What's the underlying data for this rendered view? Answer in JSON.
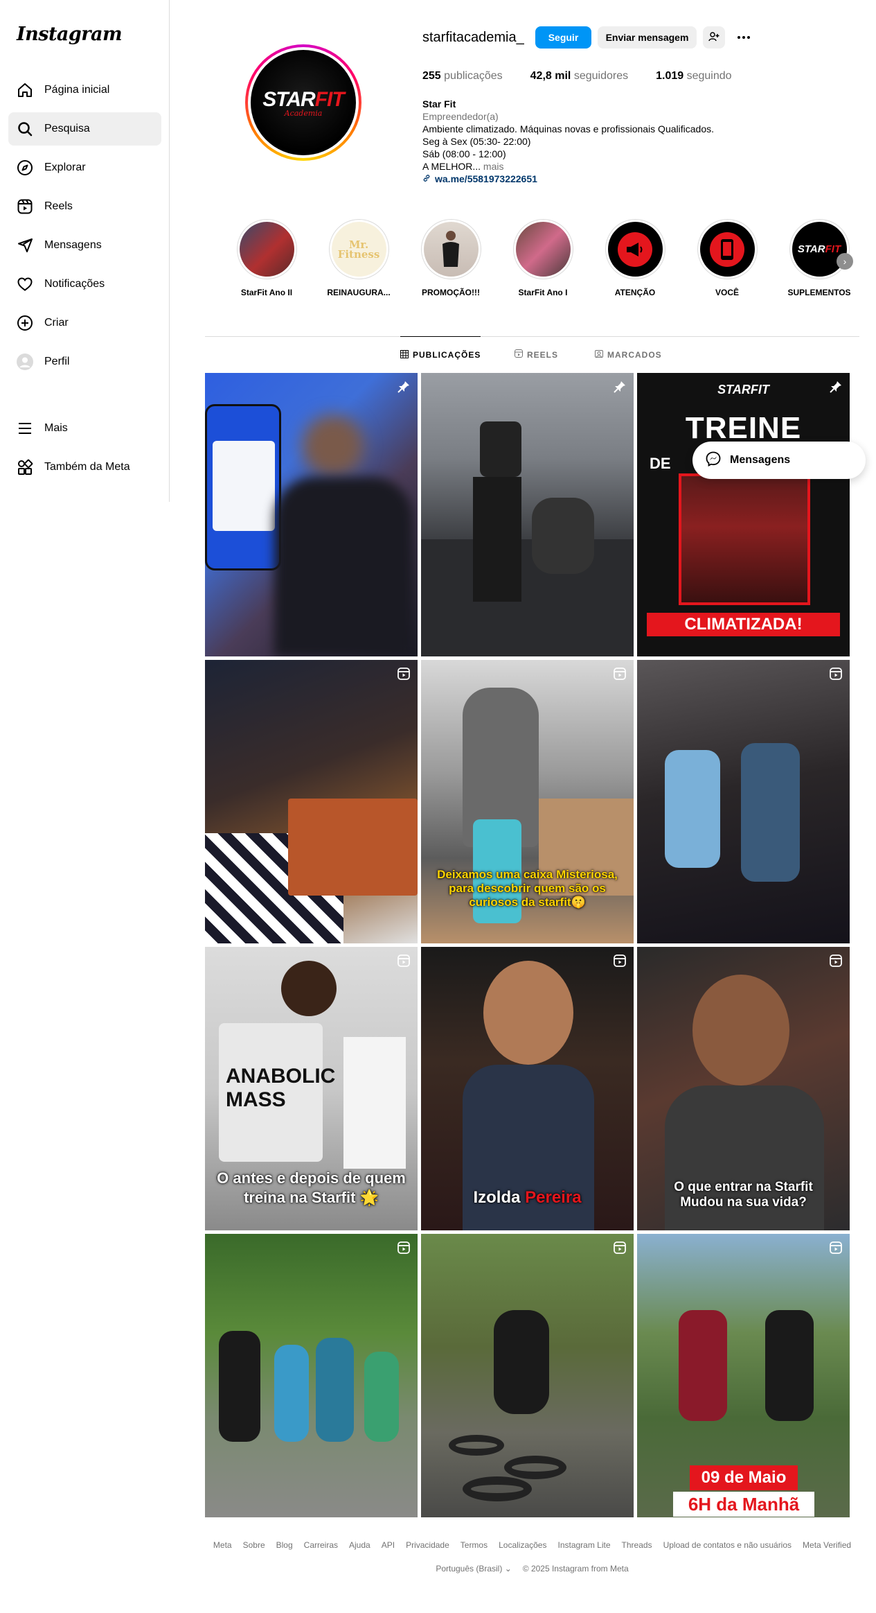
{
  "app": {
    "logo_text": "Instagram"
  },
  "sidebar": {
    "items": [
      {
        "label": "Página inicial",
        "icon": "home-icon"
      },
      {
        "label": "Pesquisa",
        "icon": "search-icon"
      },
      {
        "label": "Explorar",
        "icon": "compass-icon"
      },
      {
        "label": "Reels",
        "icon": "reels-icon"
      },
      {
        "label": "Mensagens",
        "icon": "send-icon"
      },
      {
        "label": "Notificações",
        "icon": "heart-icon"
      },
      {
        "label": "Criar",
        "icon": "plus-square-icon"
      },
      {
        "label": "Perfil",
        "icon": "profile-avatar-icon"
      },
      {
        "label": "Mais",
        "icon": "hamburger-icon"
      },
      {
        "label": "Também da Meta",
        "icon": "meta-apps-icon"
      }
    ],
    "active_index": 1
  },
  "profile": {
    "username": "starfitacademia_",
    "follow_label": "Seguir",
    "message_label": "Enviar mensagem",
    "avatar_text_a": "STAR",
    "avatar_text_b": "FIT",
    "avatar_text_c": "Academia",
    "stats": {
      "posts_num": "255",
      "posts_lbl": "publicações",
      "followers_num": "42,8 mil",
      "followers_lbl": "seguidores",
      "following_num": "1.019",
      "following_lbl": "seguindo"
    },
    "bio": {
      "name": "Star Fit",
      "category": "Empreendedor(a)",
      "line1": "Ambiente climatizado. Máquinas novas e profissionais Qualificados.",
      "line2": "Seg à Sex (05:30- 22:00)",
      "line3": "Sáb (08:00 - 12:00)",
      "line4": "A MELHOR...",
      "more": "mais",
      "link": "wa.me/5581973222651"
    }
  },
  "highlights": [
    {
      "label": "StarFit Ano II",
      "bg": "#8a2a2a"
    },
    {
      "label": "REINAUGURA...",
      "bg": "#f7f1dd",
      "inner_text": "Mr. Fitness"
    },
    {
      "label": "PROMOÇÃO!!!",
      "bg": "#d8cfc8"
    },
    {
      "label": "StarFit Ano I",
      "bg": "#a05060"
    },
    {
      "label": "ATENÇÃO",
      "bg": "#000000"
    },
    {
      "label": "VOCÊ",
      "bg": "#000000"
    },
    {
      "label": "SUPLEMENTOS",
      "bg": "#000000"
    }
  ],
  "tabs": [
    {
      "label": "PUBLICAÇÕES",
      "icon": "grid-icon"
    },
    {
      "label": "REELS",
      "icon": "reels-icon"
    },
    {
      "label": "MARCADOS",
      "icon": "tagged-icon"
    }
  ],
  "posts": [
    {
      "type": "pinned",
      "bg": "linear-gradient(135deg,#2e5fe0 0%,#3f6fd8 35%,#4a3c58 60%,#1a1a24 100%)"
    },
    {
      "type": "pinned",
      "bg": "linear-gradient(180deg,#9a9ea4 0%,#7a7e84 30%,#3a3c40 60%,#2a2b2e 100%)"
    },
    {
      "type": "pinned",
      "bg": "#111111",
      "text_a": "STARFIT",
      "text_b": "TREINE",
      "text_c": "DE",
      "text_d": "CLIMATIZADA!"
    },
    {
      "type": "reel",
      "bg": "linear-gradient(160deg,#1d2436 0%,#3a2c2a 40%,#8c5a2e 70%,#e0e0e0 100%)"
    },
    {
      "type": "reel",
      "bg": "linear-gradient(180deg,#d8d8d8 0%,#9a9a9a 40%,#5c5c5c 70%,#b8906a 100%)",
      "caption": "Deixamos uma caixa Misteriosa, para descobrir quem são os curiosos da starfit🤫"
    },
    {
      "type": "reel",
      "bg": "linear-gradient(170deg,#5a5658 0%,#2a2628 45%,#14121a 100%)"
    },
    {
      "type": "reel",
      "bg": "linear-gradient(180deg,#dcdcdc 0%,#c8c8c8 50%,#8a8a8a 100%)",
      "caption": "O antes e depois de quem treina na Starfit 🌟"
    },
    {
      "type": "reel",
      "bg": "linear-gradient(180deg,#1a1a1a 0%,#3a2a22 40%,#2a1818 100%)",
      "caption_a": "Izolda",
      "caption_b": "Pereira"
    },
    {
      "type": "reel",
      "bg": "linear-gradient(160deg,#2a2a2a 0%,#5a3a30 45%,#2c2c2e 100%)",
      "caption": "O que entrar na Starfit Mudou na sua vida?"
    },
    {
      "type": "reel",
      "bg": "linear-gradient(180deg,#3a6a2a 0%,#5a8a3a 35%,#7a8a70 65%,#8a8a88 100%)"
    },
    {
      "type": "reel",
      "bg": "linear-gradient(180deg,#6a8a4a 0%,#5a6a3a 40%,#6a6a60 70%,#4a4a48 100%)"
    },
    {
      "type": "reel",
      "bg": "linear-gradient(180deg,#8ab0d0 0%,#6a8a50 35%,#4a6a38 65%,#5a6a4a 100%)",
      "caption_a": "09 de Maio",
      "caption_b": "6H da Manhã"
    }
  ],
  "messages_popup": {
    "label": "Mensagens"
  },
  "footer": {
    "links": [
      "Meta",
      "Sobre",
      "Blog",
      "Carreiras",
      "Ajuda",
      "API",
      "Privacidade",
      "Termos",
      "Localizações",
      "Instagram Lite",
      "Threads",
      "Upload de contatos e não usuários",
      "Meta Verified"
    ],
    "language": "Português (Brasil)",
    "copyright": "© 2025 Instagram from Meta"
  }
}
